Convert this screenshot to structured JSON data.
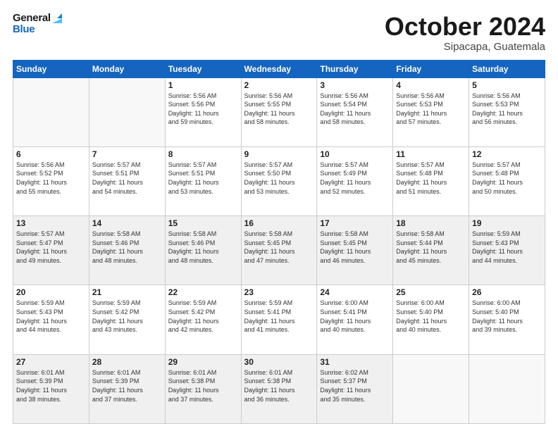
{
  "header": {
    "logo_line1": "General",
    "logo_line2": "Blue",
    "month_title": "October 2024",
    "location": "Sipacapa, Guatemala"
  },
  "weekdays": [
    "Sunday",
    "Monday",
    "Tuesday",
    "Wednesday",
    "Thursday",
    "Friday",
    "Saturday"
  ],
  "weeks": [
    [
      {
        "day": "",
        "info": ""
      },
      {
        "day": "",
        "info": ""
      },
      {
        "day": "1",
        "info": "Sunrise: 5:56 AM\nSunset: 5:56 PM\nDaylight: 11 hours\nand 59 minutes."
      },
      {
        "day": "2",
        "info": "Sunrise: 5:56 AM\nSunset: 5:55 PM\nDaylight: 11 hours\nand 58 minutes."
      },
      {
        "day": "3",
        "info": "Sunrise: 5:56 AM\nSunset: 5:54 PM\nDaylight: 11 hours\nand 58 minutes."
      },
      {
        "day": "4",
        "info": "Sunrise: 5:56 AM\nSunset: 5:53 PM\nDaylight: 11 hours\nand 57 minutes."
      },
      {
        "day": "5",
        "info": "Sunrise: 5:56 AM\nSunset: 5:53 PM\nDaylight: 11 hours\nand 56 minutes."
      }
    ],
    [
      {
        "day": "6",
        "info": "Sunrise: 5:56 AM\nSunset: 5:52 PM\nDaylight: 11 hours\nand 55 minutes."
      },
      {
        "day": "7",
        "info": "Sunrise: 5:57 AM\nSunset: 5:51 PM\nDaylight: 11 hours\nand 54 minutes."
      },
      {
        "day": "8",
        "info": "Sunrise: 5:57 AM\nSunset: 5:51 PM\nDaylight: 11 hours\nand 53 minutes."
      },
      {
        "day": "9",
        "info": "Sunrise: 5:57 AM\nSunset: 5:50 PM\nDaylight: 11 hours\nand 53 minutes."
      },
      {
        "day": "10",
        "info": "Sunrise: 5:57 AM\nSunset: 5:49 PM\nDaylight: 11 hours\nand 52 minutes."
      },
      {
        "day": "11",
        "info": "Sunrise: 5:57 AM\nSunset: 5:48 PM\nDaylight: 11 hours\nand 51 minutes."
      },
      {
        "day": "12",
        "info": "Sunrise: 5:57 AM\nSunset: 5:48 PM\nDaylight: 11 hours\nand 50 minutes."
      }
    ],
    [
      {
        "day": "13",
        "info": "Sunrise: 5:57 AM\nSunset: 5:47 PM\nDaylight: 11 hours\nand 49 minutes."
      },
      {
        "day": "14",
        "info": "Sunrise: 5:58 AM\nSunset: 5:46 PM\nDaylight: 11 hours\nand 48 minutes."
      },
      {
        "day": "15",
        "info": "Sunrise: 5:58 AM\nSunset: 5:46 PM\nDaylight: 11 hours\nand 48 minutes."
      },
      {
        "day": "16",
        "info": "Sunrise: 5:58 AM\nSunset: 5:45 PM\nDaylight: 11 hours\nand 47 minutes."
      },
      {
        "day": "17",
        "info": "Sunrise: 5:58 AM\nSunset: 5:45 PM\nDaylight: 11 hours\nand 46 minutes."
      },
      {
        "day": "18",
        "info": "Sunrise: 5:58 AM\nSunset: 5:44 PM\nDaylight: 11 hours\nand 45 minutes."
      },
      {
        "day": "19",
        "info": "Sunrise: 5:59 AM\nSunset: 5:43 PM\nDaylight: 11 hours\nand 44 minutes."
      }
    ],
    [
      {
        "day": "20",
        "info": "Sunrise: 5:59 AM\nSunset: 5:43 PM\nDaylight: 11 hours\nand 44 minutes."
      },
      {
        "day": "21",
        "info": "Sunrise: 5:59 AM\nSunset: 5:42 PM\nDaylight: 11 hours\nand 43 minutes."
      },
      {
        "day": "22",
        "info": "Sunrise: 5:59 AM\nSunset: 5:42 PM\nDaylight: 11 hours\nand 42 minutes."
      },
      {
        "day": "23",
        "info": "Sunrise: 5:59 AM\nSunset: 5:41 PM\nDaylight: 11 hours\nand 41 minutes."
      },
      {
        "day": "24",
        "info": "Sunrise: 6:00 AM\nSunset: 5:41 PM\nDaylight: 11 hours\nand 40 minutes."
      },
      {
        "day": "25",
        "info": "Sunrise: 6:00 AM\nSunset: 5:40 PM\nDaylight: 11 hours\nand 40 minutes."
      },
      {
        "day": "26",
        "info": "Sunrise: 6:00 AM\nSunset: 5:40 PM\nDaylight: 11 hours\nand 39 minutes."
      }
    ],
    [
      {
        "day": "27",
        "info": "Sunrise: 6:01 AM\nSunset: 5:39 PM\nDaylight: 11 hours\nand 38 minutes."
      },
      {
        "day": "28",
        "info": "Sunrise: 6:01 AM\nSunset: 5:39 PM\nDaylight: 11 hours\nand 37 minutes."
      },
      {
        "day": "29",
        "info": "Sunrise: 6:01 AM\nSunset: 5:38 PM\nDaylight: 11 hours\nand 37 minutes."
      },
      {
        "day": "30",
        "info": "Sunrise: 6:01 AM\nSunset: 5:38 PM\nDaylight: 11 hours\nand 36 minutes."
      },
      {
        "day": "31",
        "info": "Sunrise: 6:02 AM\nSunset: 5:37 PM\nDaylight: 11 hours\nand 35 minutes."
      },
      {
        "day": "",
        "info": ""
      },
      {
        "day": "",
        "info": ""
      }
    ]
  ]
}
